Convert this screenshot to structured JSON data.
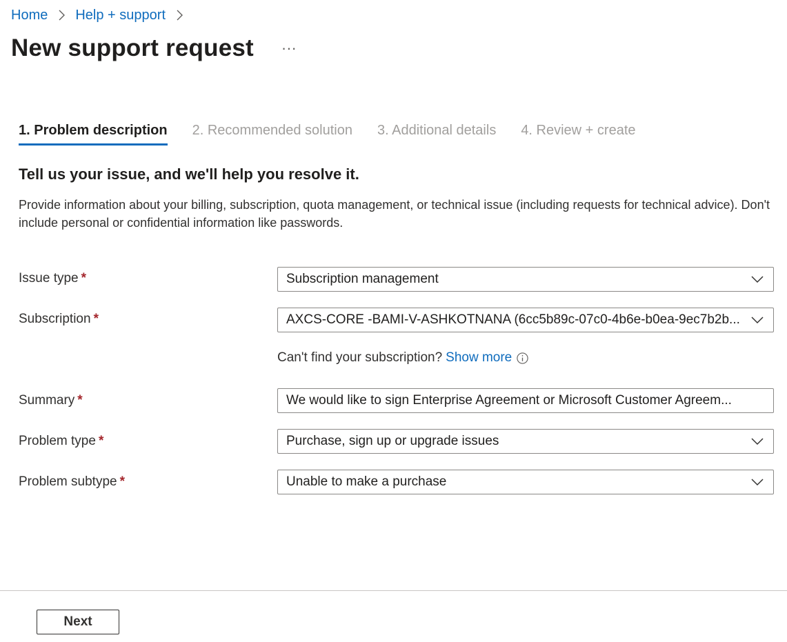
{
  "breadcrumb": {
    "items": [
      "Home",
      "Help + support"
    ]
  },
  "page": {
    "title": "New support request",
    "more_label": "···"
  },
  "tabs": [
    {
      "label": "1. Problem description",
      "active": true
    },
    {
      "label": "2. Recommended solution",
      "active": false
    },
    {
      "label": "3. Additional details",
      "active": false
    },
    {
      "label": "4. Review + create",
      "active": false
    }
  ],
  "intro": {
    "heading": "Tell us your issue, and we'll help you resolve it.",
    "description": "Provide information about your billing, subscription, quota management, or technical issue (including requests for technical advice). Don't include personal or confidential information like passwords."
  },
  "form": {
    "required_marker": "*",
    "issue_type": {
      "label": "Issue type",
      "value": "Subscription management"
    },
    "subscription": {
      "label": "Subscription",
      "value": "AXCS-CORE -BAMI-V-ASHKOTNANA (6cc5b89c-07c0-4b6e-b0ea-9ec7b2b...",
      "hint": "Can't find your subscription?",
      "hint_link": "Show more"
    },
    "summary": {
      "label": "Summary",
      "value": "We would like to sign Enterprise Agreement or Microsoft Customer Agreem..."
    },
    "problem_type": {
      "label": "Problem type",
      "value": "Purchase, sign up or upgrade issues"
    },
    "problem_subtype": {
      "label": "Problem subtype",
      "value": "Unable to make a purchase"
    }
  },
  "footer": {
    "next_label": "Next"
  },
  "colors": {
    "accent": "#0f6cbd",
    "required": "#a4262c",
    "muted_tab": "#a19f9d"
  }
}
